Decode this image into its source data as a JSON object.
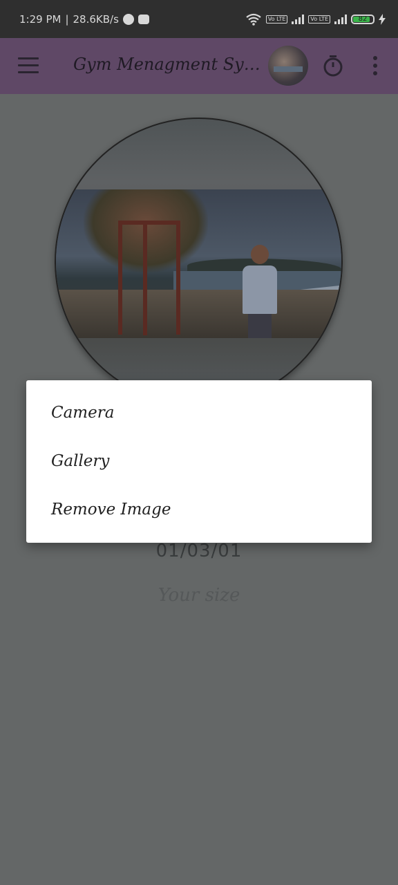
{
  "status_bar": {
    "time": "1:29 PM",
    "separator": "|",
    "net_speed": "28.6KB/s",
    "lte1": "Vo LTE",
    "lte2": "Vo LTE",
    "battery_level": "82",
    "icons": [
      "spotify-icon",
      "app-icon",
      "wifi-icon",
      "signal-icon",
      "signal-icon",
      "charging-icon"
    ]
  },
  "app_bar": {
    "title": "Gym Menagment Syst...",
    "icons": [
      "menu-icon",
      "avatar",
      "timer-icon",
      "more-vert-icon"
    ],
    "bar_color": "#5f4866"
  },
  "profile": {
    "image_alt_icon": "profile-photo"
  },
  "form": {
    "date_value": "01/03/01",
    "size_placeholder": "Your size"
  },
  "dialog": {
    "items": [
      {
        "label": "Camera"
      },
      {
        "label": "Gallery"
      },
      {
        "label": "Remove Image"
      }
    ]
  },
  "colors": {
    "scrim": "#646767",
    "dialog_bg": "#ffffff"
  }
}
